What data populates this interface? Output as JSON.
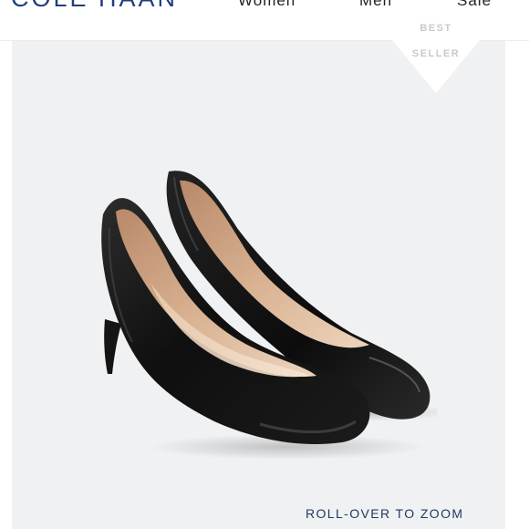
{
  "header": {
    "brand": "COLE HAAN",
    "nav": [
      "Women",
      "Men",
      "Sale"
    ]
  },
  "badge": {
    "line1": "BEST",
    "line2": "SELLER"
  },
  "product": {
    "image_label": "black-leather-pumps"
  },
  "zoom_hint": "ROLL-OVER TO ZOOM",
  "colors": {
    "brand": "#1f3f7a",
    "stage_bg": "#f0f1f2",
    "zoom_text": "#1f3b61"
  }
}
